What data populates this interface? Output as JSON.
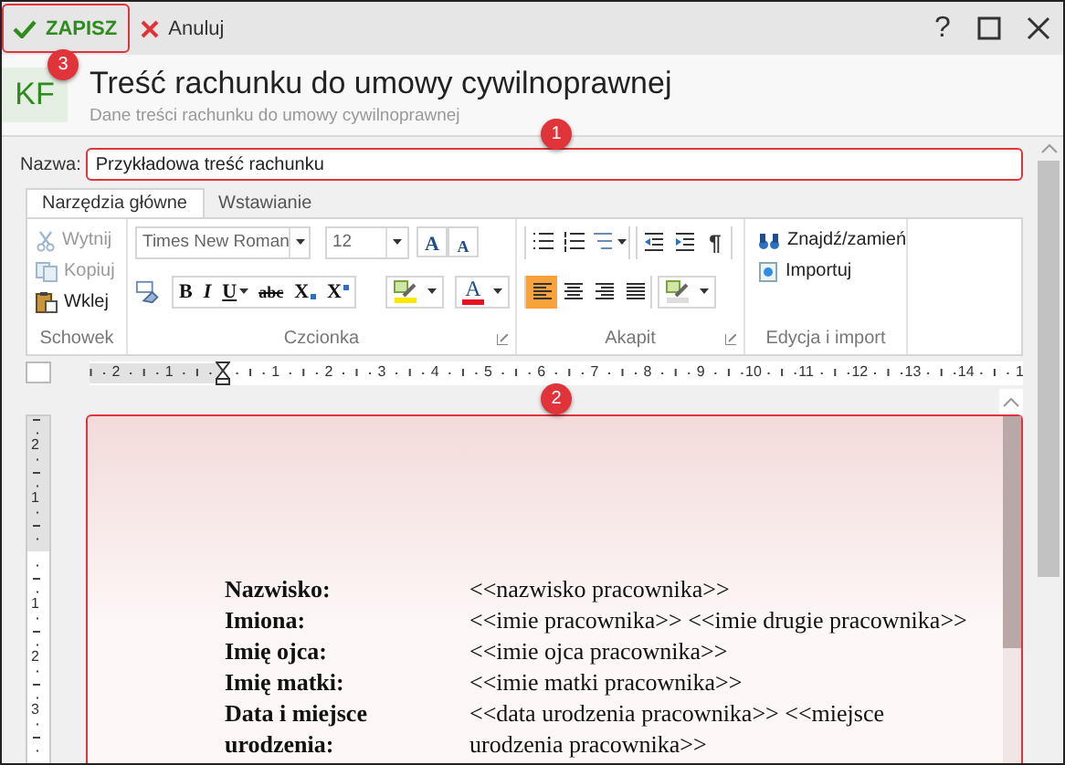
{
  "toolbar": {
    "save": "ZAPISZ",
    "cancel": "Anuluj",
    "help": "?",
    "callout": "3"
  },
  "header": {
    "logo": "KF",
    "title": "Treść rachunku do umowy cywilnoprawnej",
    "subtitle": "Dane treści rachunku do umowy cywilnoprawnej"
  },
  "name": {
    "label": "Nazwa:",
    "value": "Przykładowa treść rachunku",
    "callout": "1"
  },
  "tabs": [
    {
      "label": "Narzędzia główne",
      "selected": true
    },
    {
      "label": "Wstawianie",
      "selected": false
    }
  ],
  "ribbon": {
    "clipboard": {
      "label": "Schowek",
      "items": [
        {
          "label": "Wytnij",
          "kind": "cut",
          "disabled": true
        },
        {
          "label": "Kopiuj",
          "kind": "copy",
          "disabled": true
        },
        {
          "label": "Wklej",
          "kind": "paste",
          "disabled": false
        }
      ]
    },
    "font": {
      "label": "Czcionka",
      "family": "Times New Roman",
      "size": "12",
      "size_buttons": [
        {
          "label": "A",
          "kind": "grow"
        },
        {
          "label": "A",
          "kind": "shrink"
        }
      ],
      "format_buttons": [
        {
          "label": "B",
          "kind": "bold"
        },
        {
          "label": "I",
          "kind": "italic"
        },
        {
          "label": "U",
          "kind": "underline"
        },
        {
          "label": "abc",
          "kind": "strike"
        },
        {
          "label": "X",
          "kind": "subscript"
        },
        {
          "label": "X",
          "kind": "superscript"
        }
      ],
      "font_color": {
        "label": "A",
        "color": "#e81123"
      }
    },
    "paragraph": {
      "label": "Akapit",
      "pilcrow": "¶",
      "align_buttons": [
        {
          "kind": "left",
          "selected": true
        },
        {
          "kind": "center",
          "selected": false
        },
        {
          "kind": "right",
          "selected": false
        },
        {
          "kind": "justify",
          "selected": false
        }
      ]
    },
    "editing": {
      "label": "Edycja i import",
      "items": [
        {
          "label": "Znajdź/zamień",
          "kind": "find"
        },
        {
          "label": "Importuj",
          "kind": "import"
        }
      ]
    }
  },
  "ruler": {
    "horizontal": [
      "2",
      "1",
      "1",
      "2",
      "3",
      "4",
      "5",
      "6",
      "7",
      "8",
      "9",
      "10",
      "11",
      "12",
      "13",
      "14",
      "1"
    ],
    "vertical": [
      "2",
      "1",
      "1",
      "2",
      "3"
    ]
  },
  "document": {
    "callout": "2",
    "rows": [
      {
        "label": "Nazwisko:",
        "value": "<<nazwisko pracownika>>"
      },
      {
        "label": "Imiona:",
        "value": "<<imie pracownika>> <<imie drugie pracownika>>"
      },
      {
        "label": "Imię ojca:",
        "value": "<<imie ojca pracownika>>"
      },
      {
        "label": "Imię matki:",
        "value": "<<imie matki pracownika>>"
      },
      {
        "label": "Data i miejsce urodzenia:",
        "value": "<<data urodzenia pracownika>> <<miejsce urodzenia pracownika>>"
      }
    ]
  }
}
